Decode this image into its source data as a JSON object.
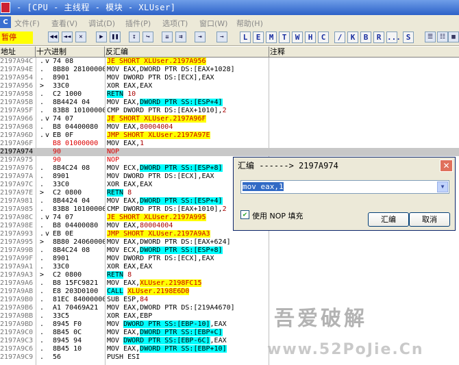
{
  "window": {
    "title": "- [CPU - 主线程 - 模块 - XLUser]"
  },
  "menu": {
    "items": [
      "文件(F)",
      "查看(V)",
      "调试(D)",
      "插件(P)",
      "选项(T)",
      "窗口(W)",
      "帮助(H)"
    ]
  },
  "toolbar": {
    "status": "暂停",
    "letters": [
      "L",
      "E",
      "M",
      "T",
      "W",
      "H",
      "C",
      "/",
      "K",
      "B",
      "R",
      "...",
      "S"
    ]
  },
  "columns": {
    "address": "地址",
    "hex": "十六进制",
    "disasm": "反汇编",
    "comment": "注释"
  },
  "rows": [
    {
      "addr": "2197A94C",
      "mk": ".",
      "jmp": "v",
      "hex": "74 08",
      "dis": [
        [
          "JE SHORT XLUser.2197A956",
          "y"
        ]
      ]
    },
    {
      "addr": "2197A94E",
      "mk": ".",
      "jmp": "",
      "hex": "8B80 28100000",
      "dis": [
        [
          "MOV EAX,DWORD PTR DS:[EAX+1028]",
          ""
        ]
      ]
    },
    {
      "addr": "2197A954",
      "mk": ".",
      "jmp": "",
      "hex": "8901",
      "dis": [
        [
          "MOV DWORD PTR DS:[ECX],EAX",
          ""
        ]
      ]
    },
    {
      "addr": "2197A956",
      "mk": ">",
      "jmp": "",
      "hex": "33C0",
      "dis": [
        [
          "XOR EAX,EAX",
          ""
        ]
      ]
    },
    {
      "addr": "2197A958",
      "mk": ".",
      "jmp": "",
      "hex": "C2 1000",
      "dis": [
        [
          "RETN",
          "c"
        ],
        [
          " 10",
          "d"
        ]
      ]
    },
    {
      "addr": "2197A95B",
      "mk": ".",
      "jmp": "",
      "hex": "8B4424 04",
      "dis": [
        [
          "MOV EAX,",
          ""
        ],
        [
          "DWORD PTR SS:[ESP+4]",
          "c"
        ]
      ]
    },
    {
      "addr": "2197A95F",
      "mk": ".",
      "jmp": "",
      "hex": "83B8 10100000",
      "dis": [
        [
          "CMP DWORD PTR DS:[EAX+1010],",
          ""
        ],
        [
          "2",
          "d"
        ]
      ]
    },
    {
      "addr": "2197A966",
      "mk": ".",
      "jmp": "v",
      "hex": "74 07",
      "dis": [
        [
          "JE SHORT XLUser.2197A96F",
          "y"
        ]
      ]
    },
    {
      "addr": "2197A968",
      "mk": ".",
      "jmp": "",
      "hex": "B8 04400080",
      "dis": [
        [
          "MOV EAX,",
          ""
        ],
        [
          "80004004",
          "d"
        ]
      ]
    },
    {
      "addr": "2197A96D",
      "mk": ".",
      "jmp": "v",
      "hex": "EB 0F",
      "dis": [
        [
          "JMP SHORT XLUser.2197A97E",
          "y"
        ]
      ]
    },
    {
      "addr": "2197A96F",
      "mk": "",
      "jmp": "",
      "hex": "B8 01000000",
      "hexred": true,
      "dis": [
        [
          "MOV EAX,",
          ""
        ],
        [
          "1",
          "d"
        ]
      ]
    },
    {
      "addr": "2197A974",
      "mk": "",
      "jmp": "",
      "hex": "90",
      "hexred": true,
      "sel": true,
      "dis": [
        [
          "NOP",
          "r"
        ]
      ]
    },
    {
      "addr": "2197A975",
      "mk": "",
      "jmp": "",
      "hex": "90",
      "hexred": true,
      "dis": [
        [
          "NOP",
          "r"
        ]
      ]
    },
    {
      "addr": "2197A976",
      "mk": ".",
      "jmp": "",
      "hex": "8B4C24 08",
      "dis": [
        [
          "MOV ECX,",
          ""
        ],
        [
          "DWORD PTR SS:[ESP+8]",
          "c"
        ]
      ]
    },
    {
      "addr": "2197A97A",
      "mk": ".",
      "jmp": "",
      "hex": "8901",
      "dis": [
        [
          "MOV DWORD PTR DS:[ECX],EAX",
          ""
        ]
      ]
    },
    {
      "addr": "2197A97C",
      "mk": ".",
      "jmp": "",
      "hex": "33C0",
      "dis": [
        [
          "XOR EAX,EAX",
          ""
        ]
      ]
    },
    {
      "addr": "2197A97E",
      "mk": ">",
      "jmp": "",
      "hex": "C2 0800",
      "dis": [
        [
          "RETN",
          "c"
        ],
        [
          " 8",
          "d"
        ]
      ]
    },
    {
      "addr": "2197A981",
      "mk": ".",
      "jmp": "",
      "hex": "8B4424 04",
      "dis": [
        [
          "MOV EAX,",
          ""
        ],
        [
          "DWORD PTR SS:[ESP+4]",
          "c"
        ]
      ]
    },
    {
      "addr": "2197A985",
      "mk": ".",
      "jmp": "",
      "hex": "83B8 10100000",
      "dis": [
        [
          "CMP DWORD PTR DS:[EAX+1010],",
          ""
        ],
        [
          "2",
          "d"
        ]
      ]
    },
    {
      "addr": "2197A98C",
      "mk": ".",
      "jmp": "v",
      "hex": "74 07",
      "dis": [
        [
          "JE SHORT XLUser.2197A995",
          "y"
        ]
      ]
    },
    {
      "addr": "2197A98E",
      "mk": ".",
      "jmp": "",
      "hex": "B8 04400080",
      "dis": [
        [
          "MOV EAX,",
          ""
        ],
        [
          "80004004",
          "d"
        ]
      ]
    },
    {
      "addr": "2197A993",
      "mk": ".",
      "jmp": "v",
      "hex": "EB 0E",
      "dis": [
        [
          "JMP SHORT XLUser.2197A9A3",
          "y"
        ]
      ]
    },
    {
      "addr": "2197A995",
      "mk": ">",
      "jmp": "",
      "hex": "8B80 24060000",
      "dis": [
        [
          "MOV EAX,DWORD PTR DS:[EAX+624]",
          ""
        ]
      ]
    },
    {
      "addr": "2197A99B",
      "mk": ".",
      "jmp": "",
      "hex": "8B4C24 08",
      "dis": [
        [
          "MOV ECX,",
          ""
        ],
        [
          "DWORD PTR SS:[ESP+8]",
          "c"
        ]
      ]
    },
    {
      "addr": "2197A99F",
      "mk": ".",
      "jmp": "",
      "hex": "8901",
      "dis": [
        [
          "MOV DWORD PTR DS:[ECX],EAX",
          ""
        ]
      ]
    },
    {
      "addr": "2197A9A1",
      "mk": ".",
      "jmp": "",
      "hex": "33C0",
      "dis": [
        [
          "XOR EAX,EAX",
          ""
        ]
      ]
    },
    {
      "addr": "2197A9A3",
      "mk": ">",
      "jmp": "",
      "hex": "C2 0800",
      "dis": [
        [
          "RETN",
          "c"
        ],
        [
          " 8",
          "d"
        ]
      ]
    },
    {
      "addr": "2197A9A6",
      "mk": ".",
      "jmp": "",
      "hex": "B8 15FC9821",
      "dis": [
        [
          "MOV EAX,",
          ""
        ],
        [
          "XLUser.2198FC15",
          "y"
        ]
      ]
    },
    {
      "addr": "2197A9AB",
      "mk": ".",
      "jmp": "",
      "hex": "E8 203D0100",
      "dis": [
        [
          "CALL",
          "c"
        ],
        [
          " ",
          ""
        ],
        [
          "XLUser.2198E6D0",
          "y"
        ]
      ]
    },
    {
      "addr": "2197A9B0",
      "mk": ".",
      "jmp": "",
      "hex": "81EC 84000000",
      "dis": [
        [
          "SUB ESP,",
          ""
        ],
        [
          "84",
          "d"
        ]
      ]
    },
    {
      "addr": "2197A9B6",
      "mk": ".",
      "jmp": "",
      "hex": "A1 70469A21",
      "dis": [
        [
          "MOV EAX,DWORD PTR DS:[219A4670]",
          ""
        ]
      ]
    },
    {
      "addr": "2197A9BB",
      "mk": ".",
      "jmp": "",
      "hex": "33C5",
      "dis": [
        [
          "XOR EAX,EBP",
          ""
        ]
      ]
    },
    {
      "addr": "2197A9BD",
      "mk": ".",
      "jmp": "",
      "hex": "8945 F0",
      "dis": [
        [
          "MOV ",
          ""
        ],
        [
          "DWORD PTR SS:[EBP-10]",
          "c"
        ],
        [
          ",EAX",
          ""
        ]
      ]
    },
    {
      "addr": "2197A9C0",
      "mk": ".",
      "jmp": "",
      "hex": "8B45 0C",
      "dis": [
        [
          "MOV EAX,",
          ""
        ],
        [
          "DWORD PTR SS:[EBP+C]",
          "c"
        ]
      ]
    },
    {
      "addr": "2197A9C3",
      "mk": ".",
      "jmp": "",
      "hex": "8945 94",
      "dis": [
        [
          "MOV ",
          ""
        ],
        [
          "DWORD PTR SS:[EBP-6C]",
          "c"
        ],
        [
          ",EAX",
          ""
        ]
      ]
    },
    {
      "addr": "2197A9C6",
      "mk": ".",
      "jmp": "",
      "hex": "8B45 10",
      "dis": [
        [
          "MOV EAX,",
          ""
        ],
        [
          "DWORD PTR SS:[EBP+10]",
          "c"
        ]
      ]
    },
    {
      "addr": "2197A9C9",
      "mk": ".",
      "jmp": "",
      "hex": "56",
      "dis": [
        [
          "PUSH ESI",
          ""
        ]
      ]
    }
  ],
  "dialog": {
    "title": "汇编 ------> 2197A974",
    "input_value": "mov eax,1",
    "nop_label": "使用 NOP 填充",
    "nop_checked": true,
    "assemble": "汇编",
    "cancel": "取消"
  },
  "watermark": {
    "line1": "吾爱破解",
    "line2": "www.52PoJie.Cn"
  }
}
